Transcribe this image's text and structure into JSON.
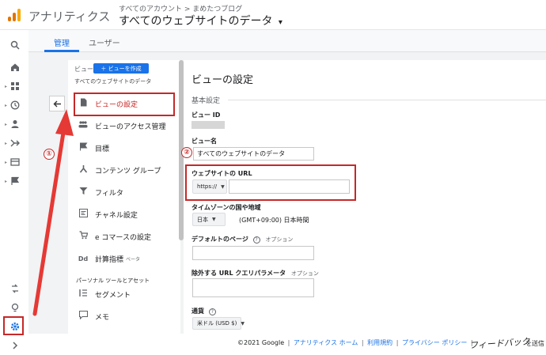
{
  "header": {
    "app_title": "アナリティクス",
    "breadcrumb": "すべてのアカウント > まめたつブログ",
    "property_title": "すべてのウェブサイトのデータ",
    "property_caret": "▾",
    "logo_colors": [
      "#F9AB00",
      "#E37400",
      "#E37400"
    ]
  },
  "tabs": {
    "admin": "管理",
    "user": "ユーザー"
  },
  "left_nav": {
    "icons": [
      "search-icon",
      "home-icon",
      "customization-icon",
      "clock-icon",
      "person-icon",
      "acquisition-icon",
      "behavior-icon",
      "flag-icon",
      "share-icon",
      "lightbulb-icon",
      "gear-icon",
      "expand-icon"
    ]
  },
  "view_panel": {
    "view_label": "ビュー",
    "create_view_button": "＋ ビューを作成",
    "current_view_name": "すべてのウェブサイトのデータ",
    "items": [
      {
        "icon": "document-icon",
        "label": "ビューの設定",
        "active": true
      },
      {
        "icon": "people-icon",
        "label": "ビューのアクセス管理"
      },
      {
        "icon": "flag-icon",
        "label": "目標"
      },
      {
        "icon": "content-group-icon",
        "label": "コンテンツ グループ"
      },
      {
        "icon": "filter-icon",
        "label": "フィルタ"
      },
      {
        "icon": "channel-icon",
        "label": "チャネル設定"
      },
      {
        "icon": "cart-icon",
        "label": "e コマースの設定"
      },
      {
        "icon": "dd-icon",
        "label": "計算指標",
        "badge": "ベータ"
      },
      {
        "icon": "segment-icon",
        "label": "セグメント"
      },
      {
        "icon": "note-icon",
        "label": "メモ"
      }
    ],
    "section_personal": "パーソナル ツールとアセット"
  },
  "settings": {
    "title": "ビューの設定",
    "section_basic": "基本設定",
    "view_id_label": "ビュー ID",
    "view_name_label": "ビュー名",
    "view_name_value": "すべてのウェブサイトのデータ",
    "website_url_label": "ウェブサイトの URL",
    "url_protocol": "https://",
    "url_value": "",
    "timezone_label": "タイムゾーンの国や地域",
    "timezone_country": "日本",
    "timezone_value": "(GMT+09:00) 日本時間",
    "default_page_label": "デフォルトのページ",
    "default_page_optional": "オプション",
    "exclude_params_label": "除外する URL クエリパラメータ",
    "exclude_params_optional": "オプション",
    "currency_label": "通貨",
    "currency_value": "米ドル (USD $)"
  },
  "annotations": {
    "one": "①",
    "two": "②"
  },
  "footer": {
    "copyright": "©2021 Google",
    "home_link": "アナリティクス ホーム",
    "terms_link": "利用規約",
    "privacy_link": "プライバシー ポリシー",
    "separator": "|",
    "feedback": "フィードバック",
    "feedback_suffix": "を送信"
  },
  "colors": {
    "accent": "#1a73e8",
    "highlight": "#c62828"
  }
}
